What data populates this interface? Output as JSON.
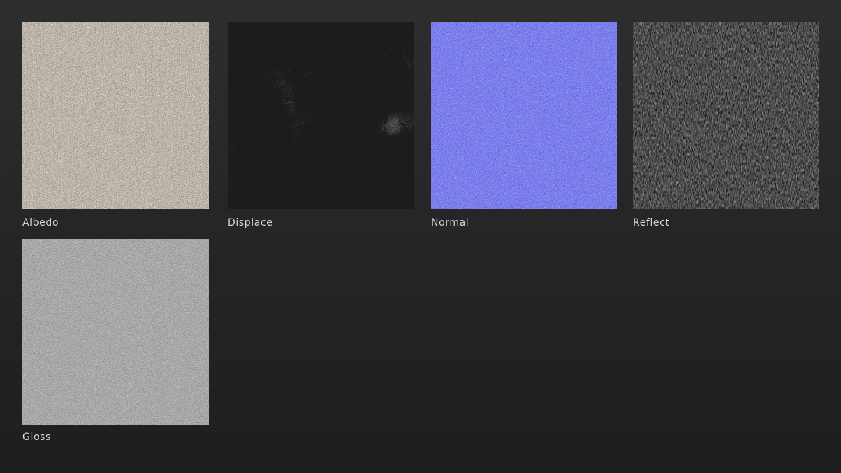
{
  "texture_maps": [
    {
      "id": "albedo",
      "label": "Albedo",
      "icon": "albedo-texture-swatch",
      "base_color": "#bfb6aa",
      "highlight_color": "#ede6d8",
      "shadow_color": "#8c8478",
      "pattern": "fine-grain"
    },
    {
      "id": "displace",
      "label": "Displace",
      "icon": "displacement-texture-swatch",
      "base_color": "#8a8a8a",
      "highlight_color": "#f2f2f2",
      "shadow_color": "#1c1c1c",
      "pattern": "cloudy-noise"
    },
    {
      "id": "normal",
      "label": "Normal",
      "icon": "normal-map-texture-swatch",
      "base_color": "#7b7ef4",
      "highlight_color": "#a4a6ff",
      "shadow_color": "#5558d8",
      "pattern": "fine-grain"
    },
    {
      "id": "reflect",
      "label": "Reflect",
      "icon": "reflection-texture-swatch",
      "base_color": "#3c3c3c",
      "highlight_color": "#8a8a8a",
      "shadow_color": "#121212",
      "pattern": "streaked-noise"
    },
    {
      "id": "gloss",
      "label": "Gloss",
      "icon": "gloss-texture-swatch",
      "base_color": "#a8a8a8",
      "highlight_color": "#cfcfcf",
      "shadow_color": "#828282",
      "pattern": "fine-grain"
    }
  ]
}
